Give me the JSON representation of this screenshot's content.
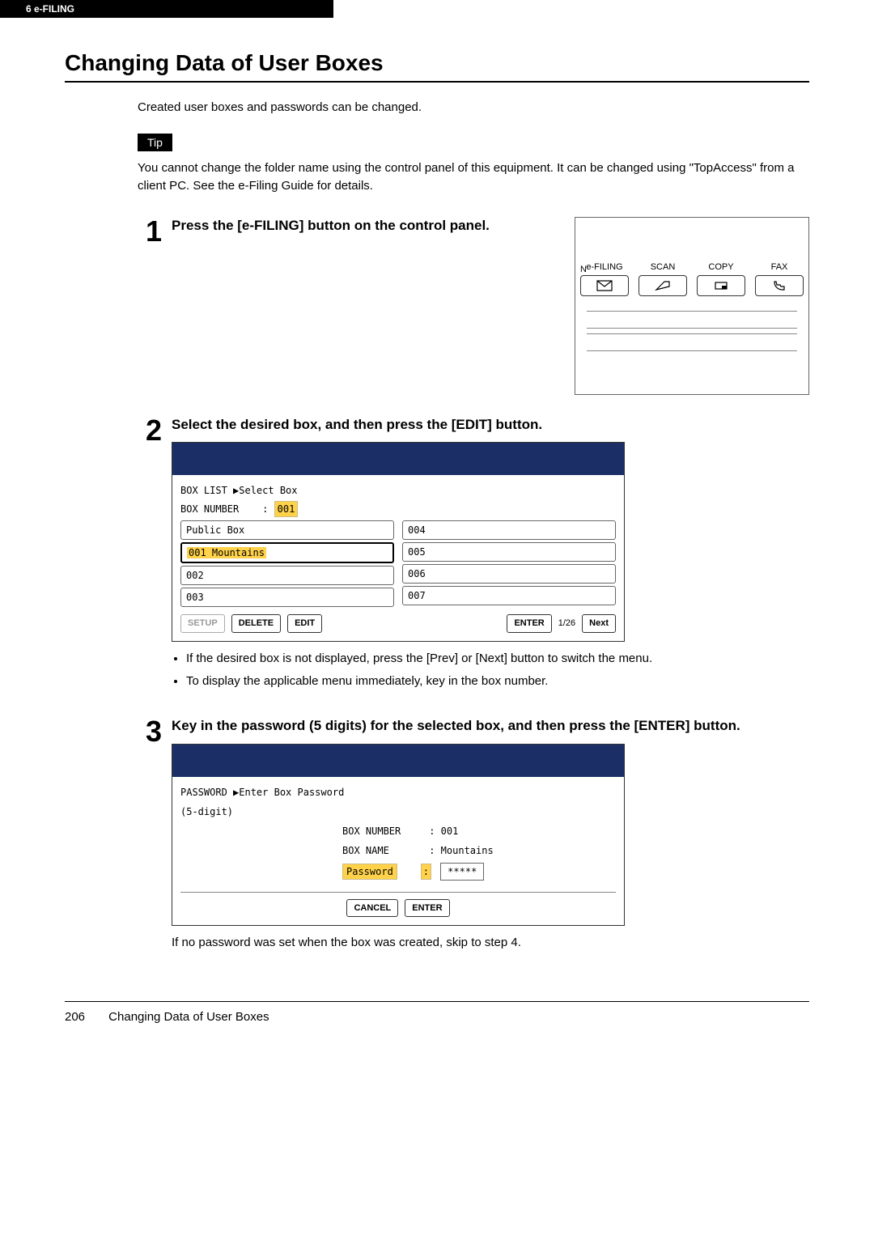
{
  "header": {
    "breadcrumb": "6  e-FILING"
  },
  "title": "Changing Data of User Boxes",
  "intro": "Created user boxes and passwords can be changed.",
  "tip_label": "Tip",
  "tip_text": "You cannot change the folder name using the control panel of this equipment. It can be changed using \"TopAccess\" from a client PC. See the e-Filing Guide for details.",
  "steps": {
    "s1": {
      "num": "1",
      "heading": "Press the [e-FILING] button on the control panel.",
      "panel": {
        "efiling": "e-FILING",
        "scan": "SCAN",
        "copy": "COPY",
        "fax": "FAX",
        "leftN": "N"
      }
    },
    "s2": {
      "num": "2",
      "heading": "Select the desired box, and then press the [EDIT] button.",
      "screen": {
        "line1a": "BOX LIST  ▶Select Box",
        "line2_label": "BOX NUMBER",
        "line2_colon": ":",
        "line2_val": "001",
        "left": [
          "Public Box",
          "001 Mountains",
          "002",
          "003"
        ],
        "right": [
          "004",
          "005",
          "006",
          "007"
        ],
        "btn_setup": "SETUP",
        "btn_delete": "DELETE",
        "btn_edit": "EDIT",
        "btn_enter": "ENTER",
        "page": "1/26",
        "btn_next": "Next"
      },
      "notes": [
        "If the desired box is not displayed, press the [Prev] or [Next] button to switch the menu.",
        "To display the applicable menu immediately, key in the box number."
      ]
    },
    "s3": {
      "num": "3",
      "heading": "Key in the password (5 digits) for the selected box, and then press the [ENTER] button.",
      "screen": {
        "line1": "PASSWORD  ▶Enter Box Password",
        "line1b": "(5-digit)",
        "boxnum_lbl": "BOX NUMBER",
        "boxnum_val": ":  001",
        "boxname_lbl": "BOX NAME",
        "boxname_val": ":  Mountains",
        "pw_lbl": "Password",
        "pw_colon": ":",
        "pw_val": "*****",
        "btn_cancel": "CANCEL",
        "btn_enter": "ENTER"
      },
      "after": "If no password was set when the box was created, skip to step 4."
    }
  },
  "footer": {
    "page": "206",
    "title": "Changing Data of User Boxes"
  }
}
